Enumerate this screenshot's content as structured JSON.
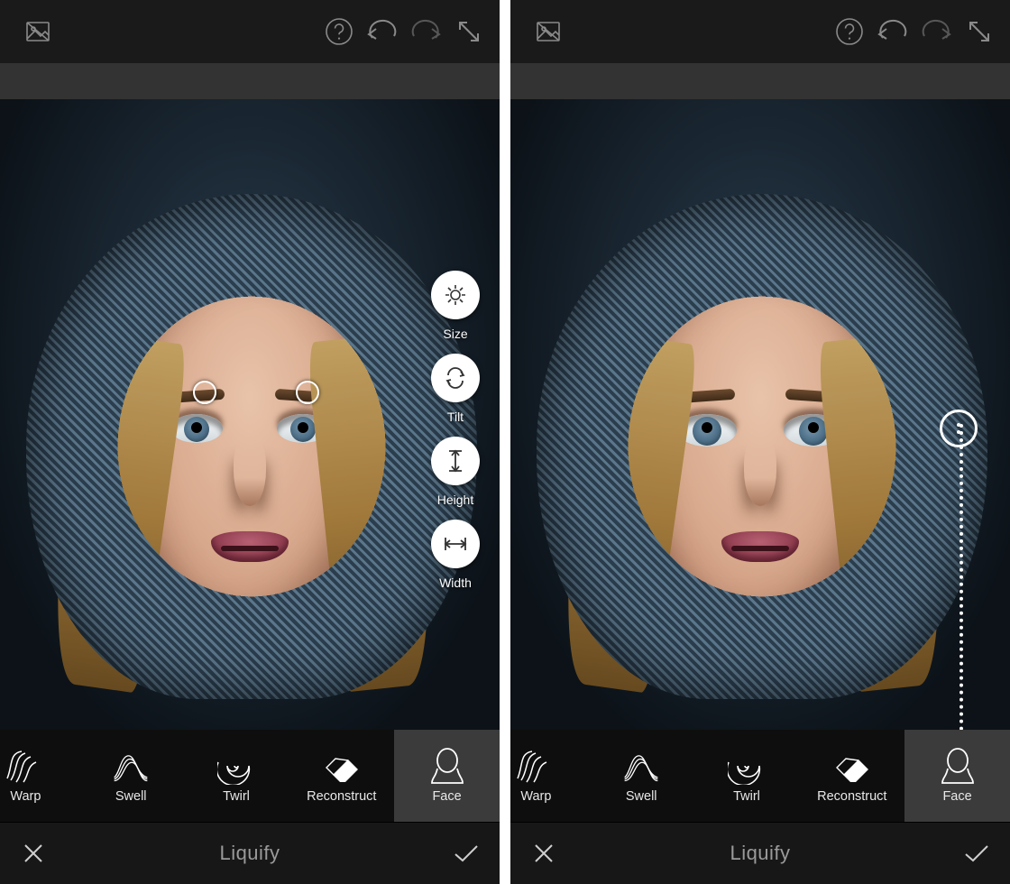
{
  "footer": {
    "title": "Liquify"
  },
  "tools": [
    {
      "id": "warp",
      "label": "Warp"
    },
    {
      "id": "swell",
      "label": "Swell"
    },
    {
      "id": "twirl",
      "label": "Twirl"
    },
    {
      "id": "reconstruct",
      "label": "Reconstruct"
    },
    {
      "id": "face",
      "label": "Face",
      "active": true
    }
  ],
  "face_options": [
    {
      "id": "size",
      "label": "Size"
    },
    {
      "id": "tilt",
      "label": "Tilt"
    },
    {
      "id": "height",
      "label": "Height"
    },
    {
      "id": "width",
      "label": "Width"
    }
  ],
  "topbar_icons": [
    "compare-original-icon",
    "help-icon",
    "undo-icon",
    "redo-icon",
    "fullscreen-icon"
  ],
  "footer_buttons": {
    "cancel": "close-icon",
    "accept": "check-icon"
  },
  "colors": {
    "active_tool_bg": "#3b3b3b",
    "icon_fg": "#8a8a8a",
    "circle_bg": "#ffffff"
  }
}
